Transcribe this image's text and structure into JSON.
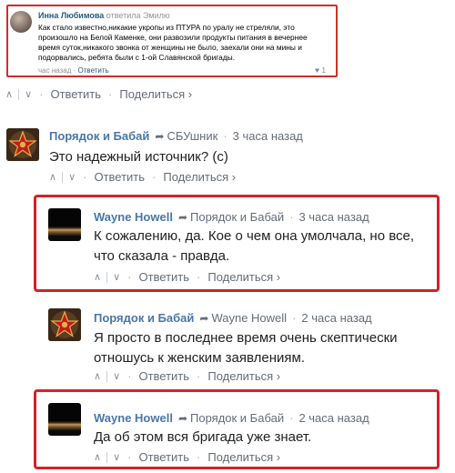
{
  "embedded": {
    "author": "Инна Любимова",
    "replied": "ответила Эмилю",
    "text": "Как стало известно,никакие укропы из ПТУРА по уралу не стреляли, это произошло на Белой Каменке, они развозили продукты питания в вечернее время суток,никакого звонка от женщины не было, заехали они на мины и подорвались, ребята были с 1-ой Славянской бригады.",
    "time": "час назад",
    "reply_link": "Ответить",
    "likes": "1"
  },
  "actions": {
    "reply": "Ответить",
    "share": "Поделиться ›"
  },
  "comments": [
    {
      "author": "Порядок и Бабай",
      "reply_to": "СБУшник",
      "time": "3 часа назад",
      "text": "Это надежный источник? (с)",
      "avatar": "red-star-icon"
    },
    {
      "author": "Wayne Howell",
      "reply_to": "Порядок и Бабай",
      "time": "3 часа назад",
      "text": "К сожалению, да. Кое о чем она умолчала, но все, что сказала - правда.",
      "avatar": "photo"
    },
    {
      "author": "Порядок и Бабай",
      "reply_to": "Wayne Howell",
      "time": "2 часа назад",
      "text": "Я просто в последнее время очень скептически отношусь к женским заявлениям.",
      "avatar": "red-star-icon"
    },
    {
      "author": "Wayne Howell",
      "reply_to": "Порядок и Бабай",
      "time": "2 часа назад",
      "text": "Да об этом вся бригада уже знает.",
      "avatar": "photo"
    }
  ],
  "colors": {
    "highlight": "#d91f26",
    "author_link": "#4a76a8",
    "meta": "#656c7a"
  }
}
